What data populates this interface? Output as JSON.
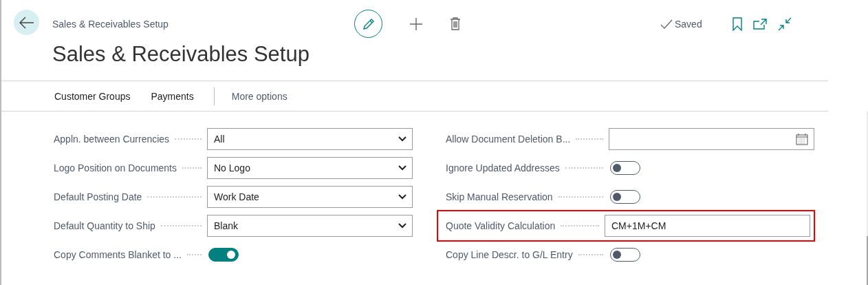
{
  "header": {
    "breadcrumb": "Sales & Receivables Setup",
    "title": "Sales & Receivables Setup",
    "status": "Saved"
  },
  "actions": [
    {
      "label": "Customer Groups",
      "kind": "action"
    },
    {
      "label": "Payments",
      "kind": "action"
    },
    {
      "label": "More options",
      "kind": "more"
    }
  ],
  "columns": [
    [
      {
        "label": "Appln. between Currencies",
        "kind": "select",
        "value": "All",
        "highlighted": false
      },
      {
        "label": "Logo Position on Documents",
        "kind": "select",
        "value": "No Logo",
        "highlighted": false
      },
      {
        "label": "Default Posting Date",
        "kind": "select",
        "value": "Work Date",
        "highlighted": false
      },
      {
        "label": "Default Quantity to Ship",
        "kind": "select",
        "value": "Blank",
        "highlighted": false
      },
      {
        "label": "Copy Comments Blanket to ...",
        "kind": "toggle",
        "on": true,
        "highlighted": false
      }
    ],
    [
      {
        "label": "Allow Document Deletion B...",
        "kind": "date",
        "highlighted": false
      },
      {
        "label": "Ignore Updated Addresses",
        "kind": "toggle",
        "on": false,
        "highlighted": false
      },
      {
        "label": "Skip Manual Reservation",
        "kind": "toggle",
        "on": false,
        "highlighted": false
      },
      {
        "label": "Quote Validity Calculation",
        "kind": "text",
        "value": "CM+1M+CM",
        "highlighted": true
      },
      {
        "label": "Copy Line Descr. to G/L Entry",
        "kind": "toggle",
        "on": false,
        "highlighted": false
      }
    ]
  ]
}
